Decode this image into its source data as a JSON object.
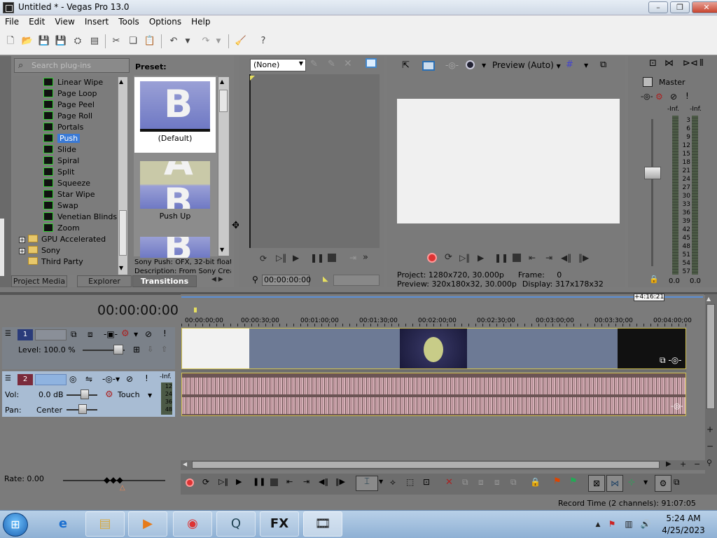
{
  "window": {
    "title": "Untitled * - Vegas Pro 13.0",
    "min": "–",
    "max": "❐",
    "close": "✕"
  },
  "menu": [
    "File",
    "Edit",
    "View",
    "Insert",
    "Tools",
    "Options",
    "Help"
  ],
  "plugins": {
    "search_placeholder": "Search plug-ins",
    "tree": [
      {
        "label": "Linear Wipe",
        "type": "fx"
      },
      {
        "label": "Page Loop",
        "type": "fx"
      },
      {
        "label": "Page Peel",
        "type": "fx"
      },
      {
        "label": "Page Roll",
        "type": "fx"
      },
      {
        "label": "Portals",
        "type": "fx"
      },
      {
        "label": "Push",
        "type": "fx",
        "selected": true
      },
      {
        "label": "Slide",
        "type": "fx"
      },
      {
        "label": "Spiral",
        "type": "fx"
      },
      {
        "label": "Split",
        "type": "fx"
      },
      {
        "label": "Squeeze",
        "type": "fx"
      },
      {
        "label": "Star Wipe",
        "type": "fx"
      },
      {
        "label": "Swap",
        "type": "fx"
      },
      {
        "label": "Venetian Blinds",
        "type": "fx"
      },
      {
        "label": "Zoom",
        "type": "fx"
      },
      {
        "label": "GPU Accelerated",
        "type": "folder",
        "expandable": true
      },
      {
        "label": "Sony",
        "type": "folder",
        "expandable": true
      },
      {
        "label": "Third Party",
        "type": "folder"
      }
    ],
    "preset_label": "Preset:",
    "presets": [
      "(Default)",
      "Push Up"
    ],
    "description_line1": "Sony Push: OFX, 32-bit float",
    "description_line2": "Description: From Sony Crea",
    "tabs": [
      "Project Media",
      "Explorer",
      "Transitions"
    ]
  },
  "trimmer": {
    "select": "(None)",
    "time": "00:00:00:00"
  },
  "preview": {
    "mode": "Preview (Auto)",
    "project_label": "Project:",
    "project": "1280x720, 30.000p",
    "frame_label": "Frame:",
    "frame": "0",
    "preview_label": "Preview:",
    "preview_val": "320x180x32, 30.000p",
    "display_label": "Display:",
    "display": "317x178x32"
  },
  "master": {
    "label": "Master",
    "inf_left": "-Inf.",
    "inf_right": "-Inf.",
    "scale": [
      "3",
      "6",
      "9",
      "12",
      "15",
      "18",
      "21",
      "24",
      "27",
      "30",
      "33",
      "36",
      "39",
      "42",
      "45",
      "48",
      "51",
      "54",
      "57"
    ],
    "val_left": "0.0",
    "val_right": "0.0"
  },
  "timeline": {
    "time": "00:00:00:00",
    "marker": "+4:16:21",
    "ruler": [
      "00:00:00;00",
      "00:00:30;00",
      "00:01:00;00",
      "00:01:30;00",
      "00:02:00;00",
      "00:02:30;00",
      "00:03:00;00",
      "00:03:30;00",
      "00:04:00;00"
    ],
    "video_track": {
      "num": "1",
      "level": "Level: 100.0 %"
    },
    "audio_track": {
      "num": "2",
      "vol_label": "Vol:",
      "vol": "0.0 dB",
      "pan_label": "Pan:",
      "pan": "Center",
      "mode": "Touch",
      "inf": "-Inf.",
      "scale": [
        "12",
        "24",
        "36",
        "48"
      ]
    },
    "rate": "Rate: 0.00",
    "status": "Record Time (2 channels): 91:07:05"
  },
  "taskbar": {
    "time": "5:24 AM",
    "date": "4/25/2023"
  }
}
